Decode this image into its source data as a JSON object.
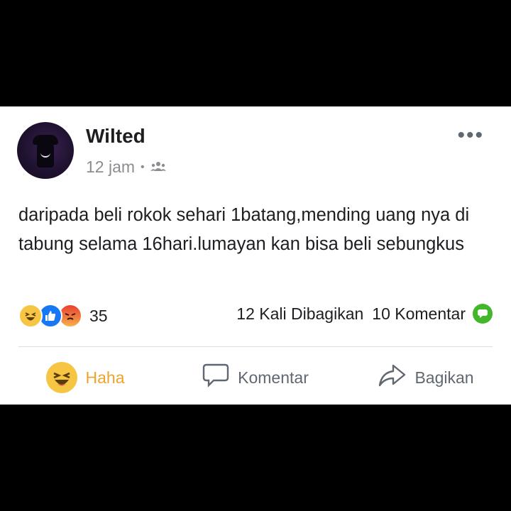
{
  "post": {
    "author": "Wilted",
    "time": "12 jam",
    "text": "daripada beli rokok sehari 1batang,mending uang nya di tabung selama 16hari.lumayan kan bisa beli sebungkus"
  },
  "stats": {
    "reaction_count": "35",
    "shares": "12 Kali Dibagikan",
    "comments": "10 Komentar",
    "reaction_icons": [
      "haha-icon",
      "like-icon",
      "angry-icon"
    ]
  },
  "actions": {
    "haha": "Haha",
    "comment": "Komentar",
    "share": "Bagikan"
  },
  "colors": {
    "haha": "#f7c544",
    "like": "#1877f2",
    "angry": "#e9412f",
    "comment_badge": "#42b72a",
    "haha_text": "#f0a32c"
  }
}
